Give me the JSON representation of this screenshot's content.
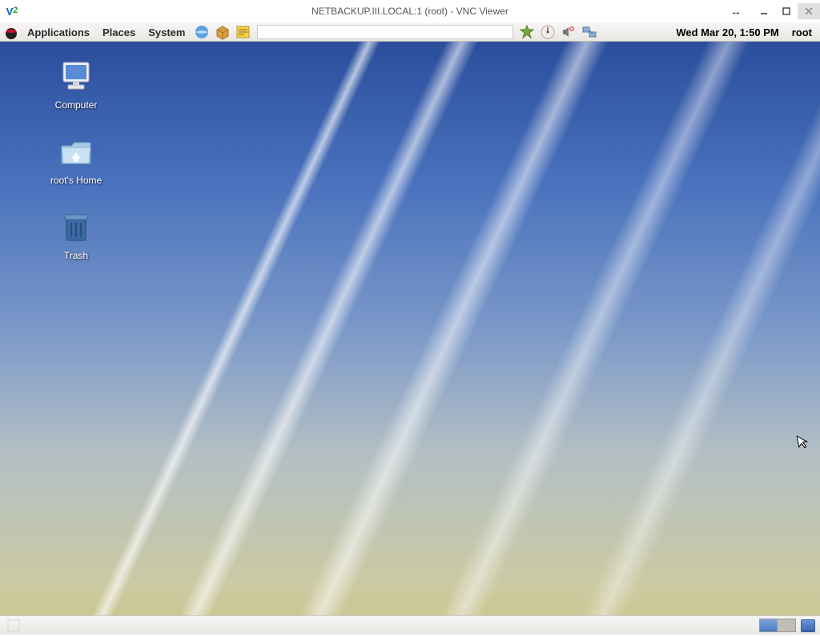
{
  "host": {
    "title": "NETBACKUP.III.LOCAL:1 (root) - VNC Viewer",
    "logo_v": "V",
    "logo_2": "2"
  },
  "panel": {
    "menus": {
      "applications": "Applications",
      "places": "Places",
      "system": "System"
    },
    "clock": "Wed Mar 20,  1:50 PM",
    "user": "root"
  },
  "desktop": {
    "icons": {
      "computer": "Computer",
      "home": "root's Home",
      "trash": "Trash"
    }
  }
}
